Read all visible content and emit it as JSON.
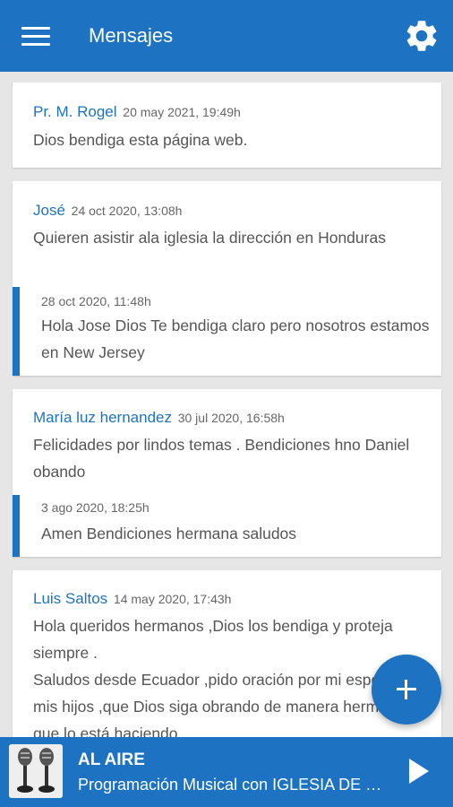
{
  "appbar": {
    "title": "Mensajes"
  },
  "messages": [
    {
      "author": "Pr. M. Rogel",
      "date": "20 may 2021, 19:49h",
      "text": "Dios bendiga esta página web."
    },
    {
      "author": "José",
      "date": "24 oct 2020, 13:08h",
      "text": "Quieren asistir ala iglesia la dirección en Honduras",
      "reply": {
        "date": "28 oct 2020, 11:48h",
        "text": "Hola Jose Dios Te bendiga claro pero nosotros estamos en New Jersey"
      }
    },
    {
      "author": "María luz hernandez",
      "date": "30 jul 2020, 16:58h",
      "text": "Felicidades por lindos temas . Bendiciones hno Daniel obando",
      "reply": {
        "date": "3 ago 2020, 18:25h",
        "text": "Amen Bendiciones hermana saludos"
      }
    },
    {
      "author": "Luis Saltos",
      "date": "14 may 2020, 17:43h",
      "text": "Hola queridos hermanos ,Dios los bendiga y proteja siempre .\nSaludos desde Ecuador ,pido oración por mi esposa y mis hijos ,que Dios siga obrando de manera hermosa que lo está haciendo"
    }
  ],
  "player": {
    "status": "AL AIRE",
    "program": "Programación Musical con IGLESIA DE CRISTO"
  },
  "colors": {
    "primary": "#1d73c2",
    "background": "#e6e6e6"
  },
  "icons": [
    "menu-icon",
    "gear-icon",
    "plus-icon",
    "play-icon"
  ]
}
